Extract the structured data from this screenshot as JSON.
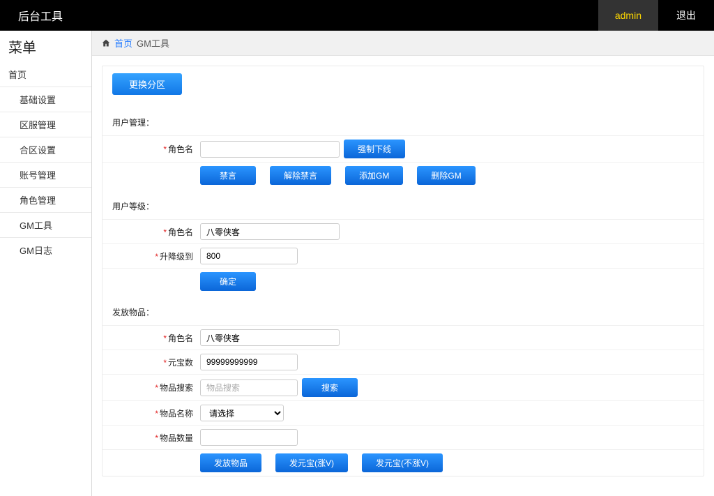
{
  "header": {
    "brand": "后台工具",
    "user": "admin",
    "logout": "退出"
  },
  "sidebar": {
    "title": "菜单",
    "home": "首页",
    "items": [
      "基础设置",
      "区服管理",
      "合区设置",
      "账号管理",
      "角色管理",
      "GM工具",
      "GM日志"
    ]
  },
  "breadcrumb": {
    "home": "首页",
    "current": "GM工具"
  },
  "top_button": "更换分区",
  "section_user_mgmt": {
    "title": "用户管理：",
    "role_label": "角色名",
    "role_value": "",
    "force_offline": "强制下线",
    "mute": "禁言",
    "unmute": "解除禁言",
    "add_gm": "添加GM",
    "del_gm": "删除GM"
  },
  "section_level": {
    "title": "用户等级：",
    "role_label": "角色名",
    "role_value": "八零侠客",
    "level_label": "升降级到",
    "level_value": "800",
    "confirm": "确定"
  },
  "section_items": {
    "title": "发放物品：",
    "role_label": "角色名",
    "role_value": "八零侠客",
    "yuanbao_label": "元宝数",
    "yuanbao_value": "99999999999",
    "search_label": "物品搜索",
    "search_placeholder": "物品搜索",
    "search_btn": "搜索",
    "name_label": "物品名称",
    "name_select": "请选择",
    "qty_label": "物品数量",
    "qty_value": "",
    "give_item": "发放物品",
    "give_yb_v": "发元宝(涨V)",
    "give_yb_nov": "发元宝(不涨V)"
  }
}
